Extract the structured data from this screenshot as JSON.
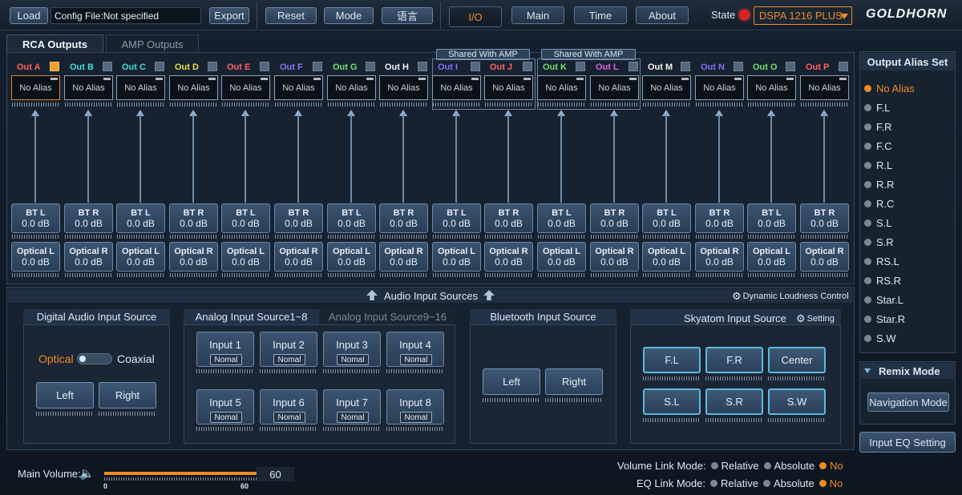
{
  "topbar": {
    "load_label": "Load",
    "config_file": "Config File:Not specified",
    "export_label": "Export",
    "reset_label": "Reset",
    "mode_label": "Mode",
    "language_label": "语言",
    "tabs": [
      "I/O",
      "Main",
      "Time",
      "About"
    ],
    "active_tab": "I/O",
    "state_label": "State",
    "device_select": "DSPA 1216 PLUS",
    "brand": "GOLDHORN",
    "colors": {
      "accent": "#f08a24",
      "state": "#e02020"
    }
  },
  "output_tabs": [
    "RCA Outputs",
    "AMP Outputs"
  ],
  "shared_labels": [
    "Shared With AMP",
    "Shared With AMP"
  ],
  "channels": [
    {
      "name": "Out A",
      "color": "#ff6060",
      "checked": true,
      "alias": "No Alias",
      "src1_t": "BT L",
      "src1_v": "0.0 dB",
      "src2_t": "Optical L",
      "src2_v": "0.0 dB"
    },
    {
      "name": "Out B",
      "color": "#40e0d8",
      "checked": false,
      "alias": "No Alias",
      "src1_t": "BT R",
      "src1_v": "0.0 dB",
      "src2_t": "Optical R",
      "src2_v": "0.0 dB"
    },
    {
      "name": "Out C",
      "color": "#40e0d8",
      "checked": false,
      "alias": "No Alias",
      "src1_t": "BT L",
      "src1_v": "0.0 dB",
      "src2_t": "Optical L",
      "src2_v": "0.0 dB"
    },
    {
      "name": "Out D",
      "color": "#e8e040",
      "checked": false,
      "alias": "No Alias",
      "src1_t": "BT R",
      "src1_v": "0.0 dB",
      "src2_t": "Optical R",
      "src2_v": "0.0 dB"
    },
    {
      "name": "Out E",
      "color": "#ff6060",
      "checked": false,
      "alias": "No Alias",
      "src1_t": "BT L",
      "src1_v": "0.0 dB",
      "src2_t": "Optical L",
      "src2_v": "0.0 dB"
    },
    {
      "name": "Out F",
      "color": "#8a70ff",
      "checked": false,
      "alias": "No Alias",
      "src1_t": "BT R",
      "src1_v": "0.0 dB",
      "src2_t": "Optical R",
      "src2_v": "0.0 dB"
    },
    {
      "name": "Out G",
      "color": "#70e070",
      "checked": false,
      "alias": "No Alias",
      "src1_t": "BT L",
      "src1_v": "0.0 dB",
      "src2_t": "Optical L",
      "src2_v": "0.0 dB"
    },
    {
      "name": "Out H",
      "color": "#f4f4f4",
      "checked": false,
      "alias": "No Alias",
      "src1_t": "BT R",
      "src1_v": "0.0 dB",
      "src2_t": "Optical R",
      "src2_v": "0.0 dB"
    },
    {
      "name": "Out I",
      "color": "#8a70ff",
      "checked": false,
      "alias": "No Alias",
      "src1_t": "BT L",
      "src1_v": "0.0 dB",
      "src2_t": "Optical L",
      "src2_v": "0.0 dB"
    },
    {
      "name": "Out J",
      "color": "#ff6060",
      "checked": false,
      "alias": "No Alias",
      "src1_t": "BT R",
      "src1_v": "0.0 dB",
      "src2_t": "Optical R",
      "src2_v": "0.0 dB"
    },
    {
      "name": "Out K",
      "color": "#70e070",
      "checked": false,
      "alias": "No Alias",
      "src1_t": "BT L",
      "src1_v": "0.0 dB",
      "src2_t": "Optical L",
      "src2_v": "0.0 dB"
    },
    {
      "name": "Out L",
      "color": "#e060e0",
      "checked": false,
      "alias": "No Alias",
      "src1_t": "BT R",
      "src1_v": "0.0 dB",
      "src2_t": "Optical R",
      "src2_v": "0.0 dB"
    },
    {
      "name": "Out M",
      "color": "#f4f4f4",
      "checked": false,
      "alias": "No Alias",
      "src1_t": "BT L",
      "src1_v": "0.0 dB",
      "src2_t": "Optical L",
      "src2_v": "0.0 dB"
    },
    {
      "name": "Out N",
      "color": "#8a70ff",
      "checked": false,
      "alias": "No Alias",
      "src1_t": "BT R",
      "src1_v": "0.0 dB",
      "src2_t": "Optical R",
      "src2_v": "0.0 dB"
    },
    {
      "name": "Out O",
      "color": "#70e070",
      "checked": false,
      "alias": "No Alias",
      "src1_t": "BT L",
      "src1_v": "0.0 dB",
      "src2_t": "Optical L",
      "src2_v": "0.0 dB"
    },
    {
      "name": "Out P",
      "color": "#ff6060",
      "checked": false,
      "alias": "No Alias",
      "src1_t": "BT R",
      "src1_v": "0.0 dB",
      "src2_t": "Optical R",
      "src2_v": "0.0 dB"
    }
  ],
  "input_section": {
    "title": "Audio Input Sources",
    "dynamic_loudness": "Dynamic Loudness Control",
    "digital": {
      "title": "Digital Audio Input Source",
      "optical": "Optical",
      "coaxial": "Coaxial",
      "left": "Left",
      "right": "Right"
    },
    "analog": {
      "tab1": "Analog Input Source1~8",
      "tab2": "Analog Input Source9~16",
      "inputs": [
        {
          "label": "Input 1",
          "mode": "Nomal"
        },
        {
          "label": "Input 2",
          "mode": "Nomal"
        },
        {
          "label": "Input 3",
          "mode": "Nomal"
        },
        {
          "label": "Input 4",
          "mode": "Nomal"
        },
        {
          "label": "Input 5",
          "mode": "Nomal"
        },
        {
          "label": "Input 6",
          "mode": "Nomal"
        },
        {
          "label": "Input 7",
          "mode": "Nomal"
        },
        {
          "label": "Input 8",
          "mode": "Nomal"
        }
      ]
    },
    "bluetooth": {
      "title": "Bluetooth Input Source",
      "left": "Left",
      "right": "Right"
    },
    "skyatom": {
      "title": "Skyatom Input Source",
      "setting": "Setting",
      "buttons": [
        "F.L",
        "F.R",
        "Center",
        "S.L",
        "S.R",
        "S.W"
      ]
    }
  },
  "alias_set": {
    "title": "Output Alias Set",
    "items": [
      "No Alias",
      "F.L",
      "F.R",
      "F.C",
      "R.L",
      "R.R",
      "R.C",
      "S.L",
      "S.R",
      "RS.L",
      "RS.R",
      "Star.L",
      "Star.R",
      "S.W"
    ],
    "selected": "No Alias"
  },
  "remix": {
    "title": "Remix Mode",
    "navigation": "Navigation Mode"
  },
  "input_eq": "Input EQ Setting",
  "volume": {
    "label": "Main Volume:",
    "value": "60",
    "min": "0",
    "level": "60",
    "max": 66
  },
  "link": {
    "volume_label": "Volume Link Mode:",
    "eq_label": "EQ Link Mode:",
    "options": [
      "Relative",
      "Absolute",
      "No"
    ],
    "selected": "No"
  }
}
